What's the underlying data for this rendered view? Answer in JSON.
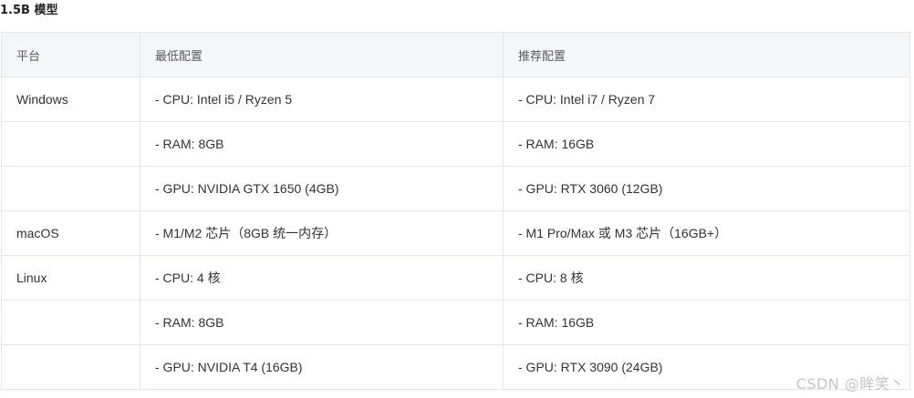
{
  "section": {
    "title": "1.5B 模型"
  },
  "table": {
    "headers": [
      "平台",
      "最低配置",
      "推荐配置"
    ],
    "rows": [
      [
        "Windows",
        "- CPU: Intel i5 / Ryzen 5",
        "- CPU: Intel i7 / Ryzen 7"
      ],
      [
        "",
        "- RAM: 8GB",
        "- RAM: 16GB"
      ],
      [
        "",
        "- GPU: NVIDIA GTX 1650 (4GB)",
        "- GPU: RTX 3060 (12GB)"
      ],
      [
        "macOS",
        "- M1/M2 芯片（8GB 统一内存）",
        "- M1 Pro/Max 或 M3 芯片（16GB+）"
      ],
      [
        "Linux",
        "- CPU: 4 核",
        "- CPU: 8 核"
      ],
      [
        "",
        "- RAM: 8GB",
        "- RAM: 16GB"
      ],
      [
        "",
        "- GPU: NVIDIA T4 (16GB)",
        "- GPU: RTX 3090 (24GB)"
      ]
    ]
  },
  "watermark": {
    "text": "CSDN @眸笑丶"
  },
  "colors": {
    "header_bg": "#f5f6f8",
    "border": "#e4e6eb",
    "text": "#333333"
  }
}
